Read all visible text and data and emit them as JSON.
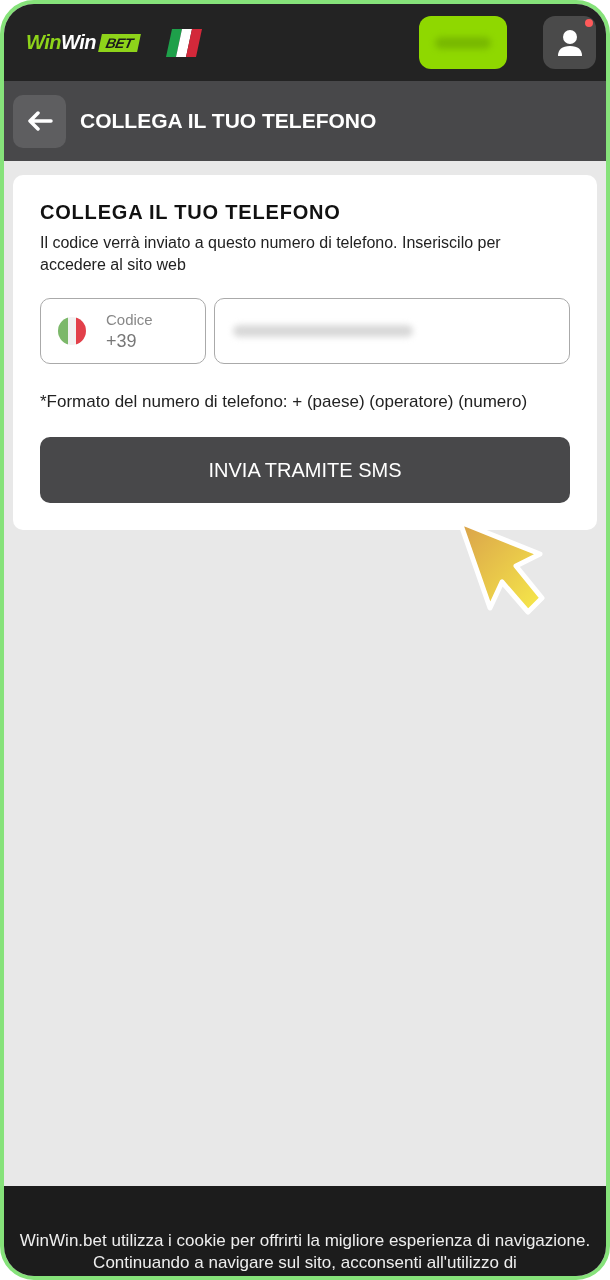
{
  "header": {
    "logo": {
      "part_1": "Win",
      "part_2": "Win",
      "badge": "BET"
    },
    "notification_dot": true
  },
  "subheader": {
    "title": "COLLEGA IL TUO TELEFONO"
  },
  "card": {
    "title": "COLLEGA IL TUO TELEFONO",
    "description": "Il codice verrà inviato a questo numero di telefono. Inseriscilo per accedere al sito web",
    "code_field": {
      "label": "Codice",
      "value": "+39"
    },
    "hint": "*Formato del numero di telefono: + (paese) (operatore) (numero)",
    "submit": "INVIA TRAMITE SMS"
  },
  "cookie_banner": {
    "text": "WinWin.bet utilizza i cookie per offrirti la migliore esperienza di navigazione. Continuando a navigare sul sito, acconsenti all'utilizzo di"
  }
}
